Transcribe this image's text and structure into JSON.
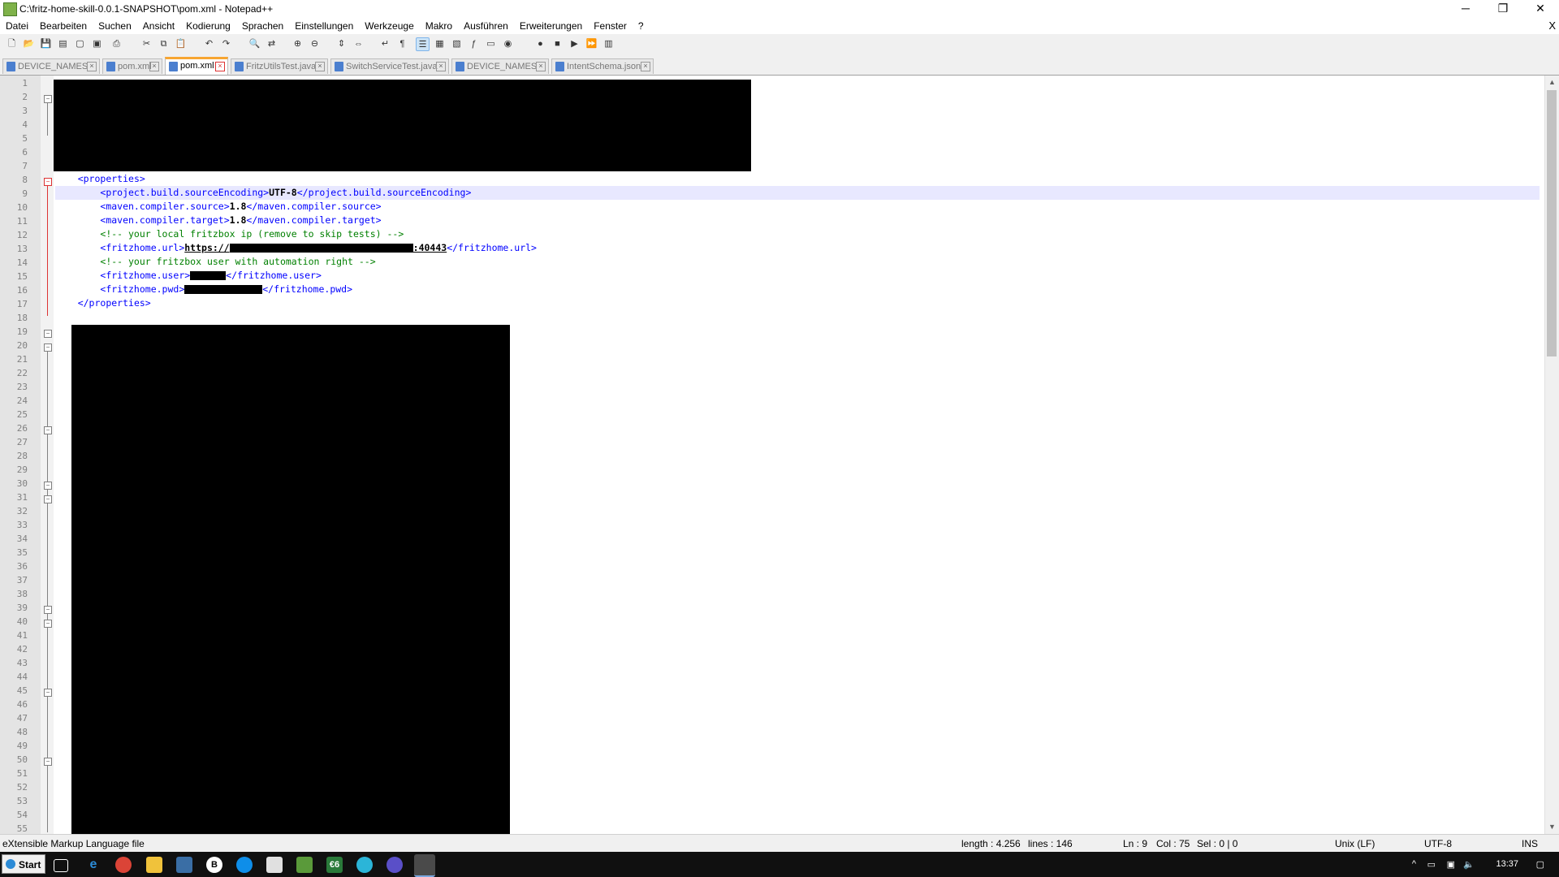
{
  "window": {
    "title": "C:\\fritz-home-skill-0.0.1-SNAPSHOT\\pom.xml - Notepad++",
    "minimize": "─",
    "maximize": "❐",
    "close": "✕"
  },
  "menu": {
    "items": [
      "Datei",
      "Bearbeiten",
      "Suchen",
      "Ansicht",
      "Kodierung",
      "Sprachen",
      "Einstellungen",
      "Werkzeuge",
      "Makro",
      "Ausführen",
      "Erweiterungen",
      "Fenster",
      "?"
    ],
    "close_doc": "X"
  },
  "toolbar": {
    "icons": [
      "new-file",
      "open-file",
      "save",
      "save-all",
      "close",
      "close-all",
      "print",
      "cut",
      "copy",
      "paste",
      "undo",
      "redo",
      "find",
      "replace",
      "zoom-in",
      "zoom-out",
      "sync-vertical",
      "sync-horizontal",
      "word-wrap",
      "show-all-chars",
      "indent-guide",
      "user-defined-language",
      "doc-map",
      "function-list",
      "folder-as-workspace",
      "monitoring",
      "record-macro",
      "stop-record",
      "playback-macro",
      "run-macro-multiple",
      "save-macro"
    ]
  },
  "tabs": [
    {
      "label": "DEVICE_NAMES",
      "active": false
    },
    {
      "label": "pom.xml",
      "active": false
    },
    {
      "label": "pom.xml",
      "active": true
    },
    {
      "label": "FritzUtilsTest.java",
      "active": false
    },
    {
      "label": "SwitchServiceTest.java",
      "active": false
    },
    {
      "label": "DEVICE_NAMES",
      "active": false
    },
    {
      "label": "IntentSchema.json",
      "active": false
    }
  ],
  "editor": {
    "line_numbers": [
      "1",
      "2",
      "3",
      "4",
      "5",
      "6",
      "7",
      "8",
      "9",
      "10",
      "11",
      "12",
      "13",
      "14",
      "15",
      "16",
      "17",
      "18",
      "19",
      "20",
      "21",
      "22",
      "23",
      "24",
      "25",
      "26",
      "27",
      "28",
      "29",
      "30",
      "31",
      "32",
      "33",
      "34",
      "35",
      "36",
      "37",
      "38",
      "39",
      "40",
      "41",
      "42",
      "43",
      "44",
      "45",
      "46",
      "47",
      "48",
      "49",
      "50",
      "51",
      "52",
      "53",
      "54",
      "55"
    ],
    "code": {
      "l8": "<properties>",
      "l9_open": "<project.build.sourceEncoding>",
      "l9_val": "UTF-8",
      "l9_close": "</project.build.sourceEncoding>",
      "l10_open": "<maven.compiler.source>",
      "l10_val": "1.8",
      "l10_close": "</maven.compiler.source>",
      "l11_open": "<maven.compiler.target>",
      "l11_val": "1.8",
      "l11_close": "</maven.compiler.target>",
      "l12": "<!-- your local fritzbox ip (remove to skip tests) -->",
      "l13_open": "<fritzhome.url>",
      "l13_url_start": "https://",
      "l13_url_end": ":40443",
      "l13_close": "</fritzhome.url>",
      "l14": "<!-- your fritzbox user with automation right -->",
      "l15_open": "<fritzhome.user>",
      "l15_close": "</fritzhome.user>",
      "l16_open": "<fritzhome.pwd>",
      "l16_close": "</fritzhome.pwd>",
      "l17": "</properties>"
    }
  },
  "status": {
    "file_type": "eXtensible Markup Language file",
    "length": "length : 4.256",
    "lines": "lines : 146",
    "ln": "Ln : 9",
    "col": "Col : 75",
    "sel": "Sel : 0 | 0",
    "eol": "Unix (LF)",
    "encoding": "UTF-8",
    "mode": "INS"
  },
  "taskbar": {
    "start": "Start",
    "icons": [
      "task-view",
      "edge",
      "chrome",
      "file-explorer",
      "network-app",
      "b-app",
      "teamviewer",
      "calculator",
      "app-icon",
      "euro-app",
      "search-app",
      "firefox-app",
      "notepad-plus-plus"
    ],
    "b_label": "B",
    "euro_label": "€6",
    "time": "13:37"
  },
  "colors": {
    "tag": "#0000ff",
    "comment": "#008000",
    "current_line": "#e8e8ff",
    "active_tab_accent": "#f7a531"
  }
}
